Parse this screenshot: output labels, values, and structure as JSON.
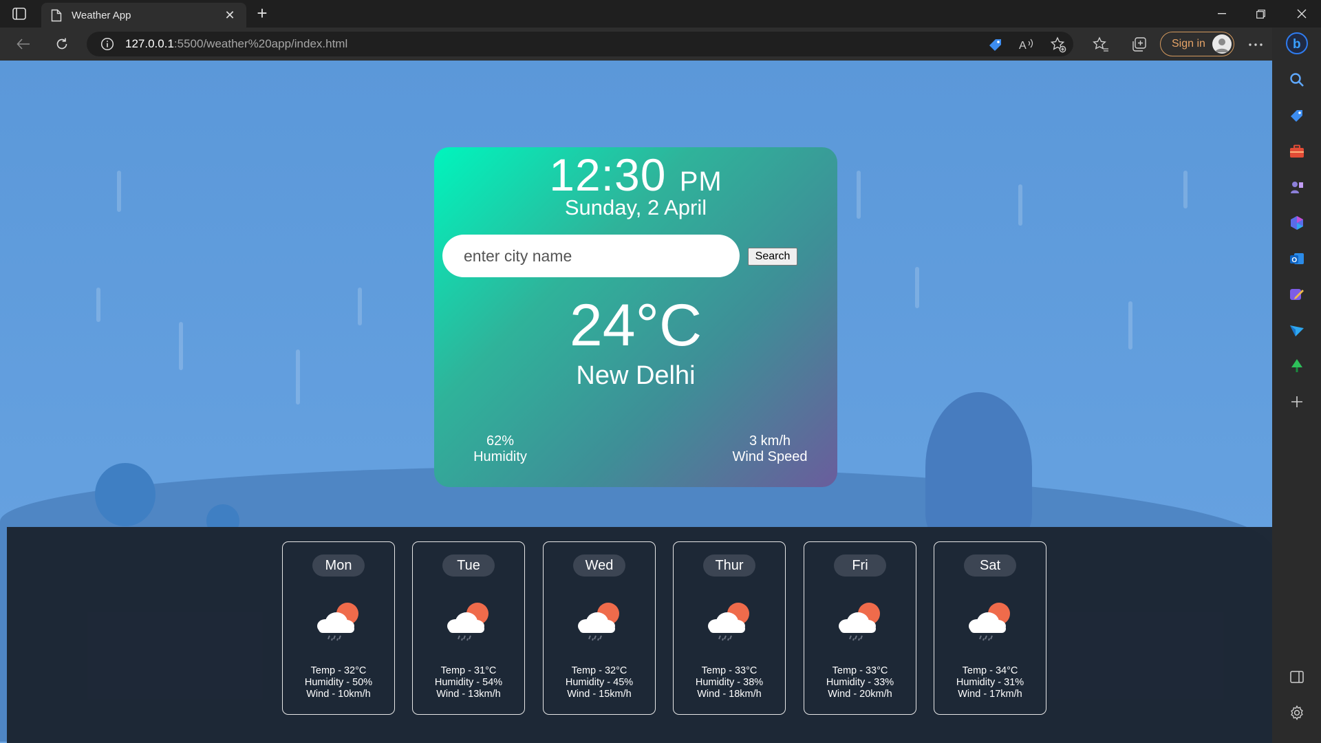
{
  "browser": {
    "tab_title": "Weather App",
    "url_host": "127.0.0.1",
    "url_path": ":5500/weather%20app/index.html",
    "signin_label": "Sign in"
  },
  "weather": {
    "time": "12:30",
    "ampm": "PM",
    "date": "Sunday, 2 April",
    "search_placeholder": "enter city name",
    "search_button": "Search",
    "temperature": "24°C",
    "city": "New Delhi",
    "humidity_value": "62%",
    "humidity_label": "Humidity",
    "wind_value": "3 km/h",
    "wind_label": "Wind Speed"
  },
  "forecast": [
    {
      "day": "Mon",
      "temp": "Temp - 32°C",
      "humidity": "Humidity - 50%",
      "wind": "Wind - 10km/h"
    },
    {
      "day": "Tue",
      "temp": "Temp - 31°C",
      "humidity": "Humidity - 54%",
      "wind": "Wind - 13km/h"
    },
    {
      "day": "Wed",
      "temp": "Temp - 32°C",
      "humidity": "Humidity - 45%",
      "wind": "Wind - 15km/h"
    },
    {
      "day": "Thur",
      "temp": "Temp - 33°C",
      "humidity": "Humidity - 38%",
      "wind": "Wind - 18km/h"
    },
    {
      "day": "Fri",
      "temp": "Temp - 33°C",
      "humidity": "Humidity - 33%",
      "wind": "Wind - 20km/h"
    },
    {
      "day": "Sat",
      "temp": "Temp - 34°C",
      "humidity": "Humidity - 31%",
      "wind": "Wind - 17km/h"
    }
  ],
  "colors": {
    "card_gradient_start": "#00f5bd",
    "card_gradient_end": "#6a5d9c",
    "sun": "#ef6b4b",
    "forecast_bg": "#1c2532"
  },
  "icons": {
    "forecast_icon": "sun-behind-rain-cloud-icon"
  }
}
